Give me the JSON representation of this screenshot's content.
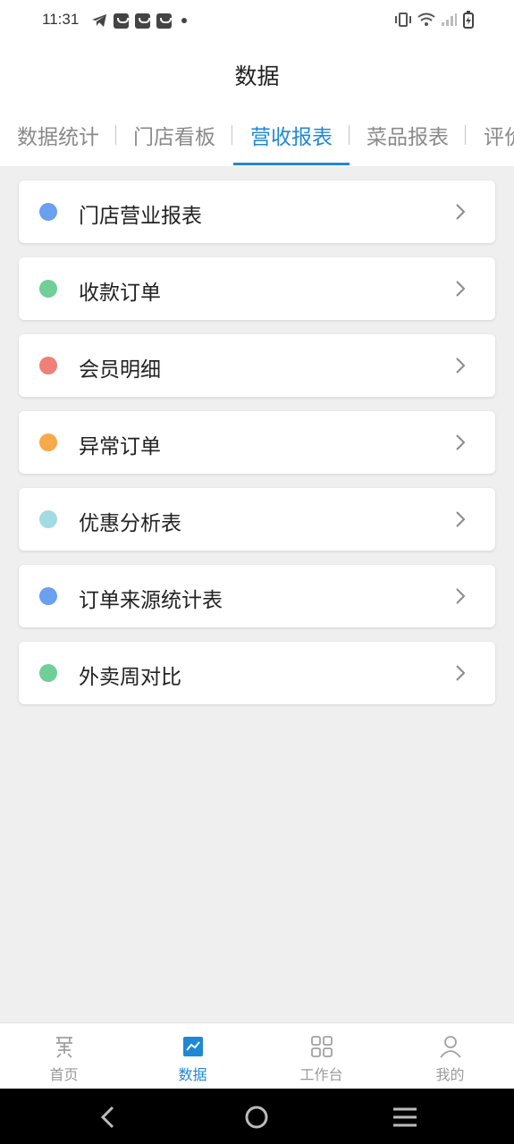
{
  "status": {
    "time": "11:31"
  },
  "header": {
    "title": "数据"
  },
  "tabs": [
    {
      "label": "数据统计",
      "active": false
    },
    {
      "label": "门店看板",
      "active": false
    },
    {
      "label": "营收报表",
      "active": true
    },
    {
      "label": "菜品报表",
      "active": false
    },
    {
      "label": "评价",
      "active": false
    }
  ],
  "reports": [
    {
      "label": "门店营业报表",
      "color": "#6b9ff0"
    },
    {
      "label": "收款订单",
      "color": "#6fcf97"
    },
    {
      "label": "会员明细",
      "color": "#f07f78"
    },
    {
      "label": "异常订单",
      "color": "#f8a94a"
    },
    {
      "label": "优惠分析表",
      "color": "#a3dbe2"
    },
    {
      "label": "订单来源统计表",
      "color": "#6b9ff0"
    },
    {
      "label": "外卖周对比",
      "color": "#6fcf97"
    }
  ],
  "tabbar": [
    {
      "label": "首页",
      "icon": "home-icon",
      "active": false
    },
    {
      "label": "数据",
      "icon": "chart-icon",
      "active": true
    },
    {
      "label": "工作台",
      "icon": "grid-icon",
      "active": false
    },
    {
      "label": "我的",
      "icon": "person-icon",
      "active": false
    }
  ],
  "colors": {
    "accent": "#1e88d6"
  }
}
